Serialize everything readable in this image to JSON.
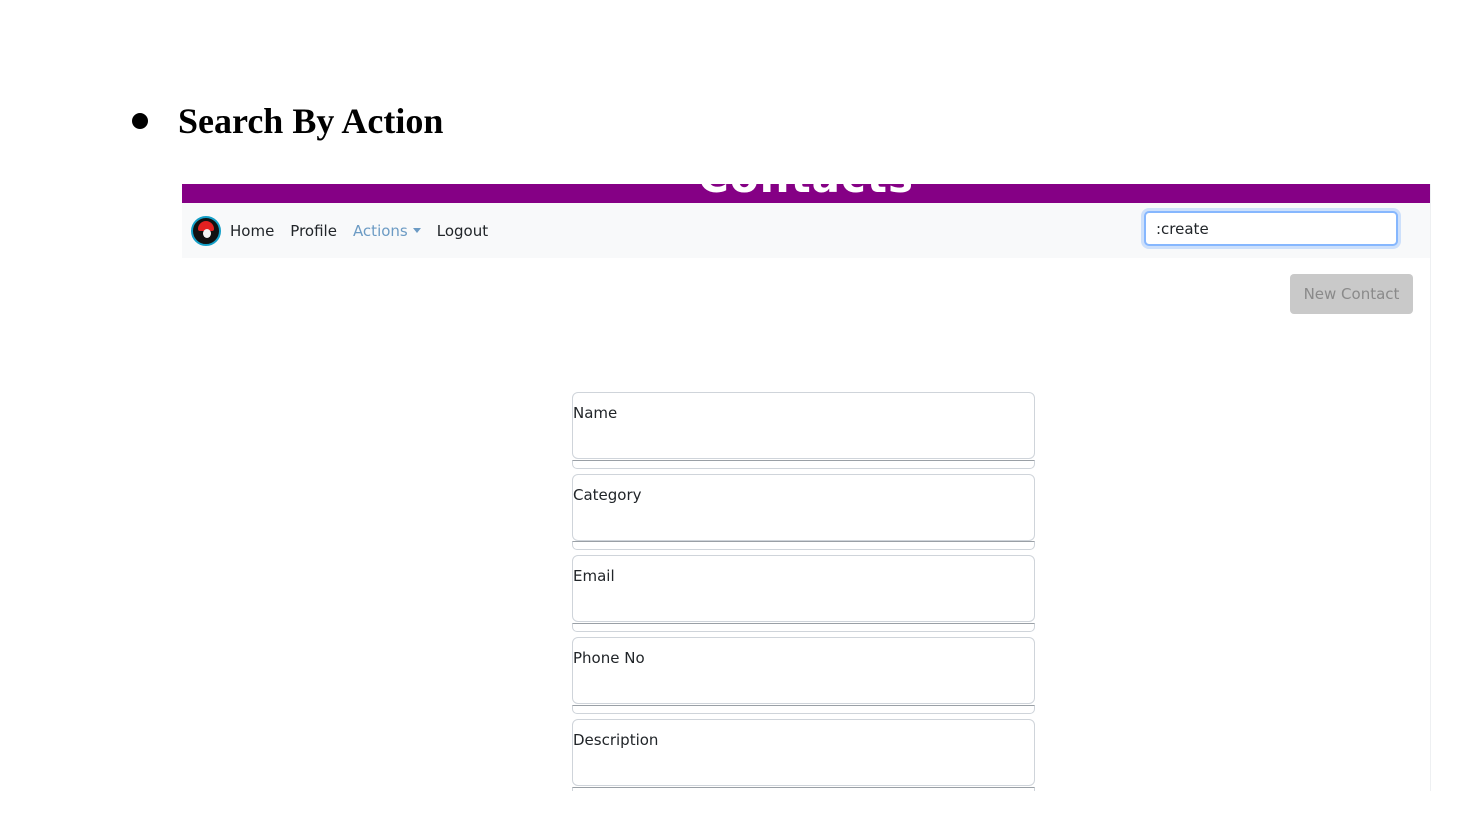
{
  "slide": {
    "heading": "Search By Action"
  },
  "app": {
    "banner_title": "Contacts",
    "nav": {
      "home": "Home",
      "profile": "Profile",
      "actions": "Actions",
      "logout": "Logout"
    },
    "search": {
      "value": ":create"
    },
    "new_contact_label": "New Contact",
    "form": {
      "fields": [
        {
          "label": "Name"
        },
        {
          "label": "Category"
        },
        {
          "label": "Email"
        },
        {
          "label": "Phone No"
        },
        {
          "label": "Description"
        }
      ]
    },
    "colors": {
      "banner": "#850085",
      "navbar": "#f8f9fa",
      "active_link": "#6c9bc4",
      "button_disabled": "#c9c9c9"
    },
    "icons": {
      "logo": "pokeball-avatar-icon",
      "dropdown": "caret-down-icon"
    }
  }
}
